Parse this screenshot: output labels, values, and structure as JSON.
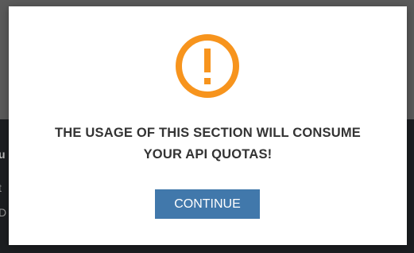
{
  "background": {
    "fragments": [
      "u",
      "t",
      "D"
    ]
  },
  "dialog": {
    "icon": "exclamation-circle-icon",
    "accent_color": "#f7941d",
    "message_line_1": "THE USAGE OF THIS SECTION WILL CONSUME",
    "message_line_2": "YOUR API QUOTAS!",
    "continue_label": "CONTINUE",
    "button_color": "#4178ab"
  }
}
